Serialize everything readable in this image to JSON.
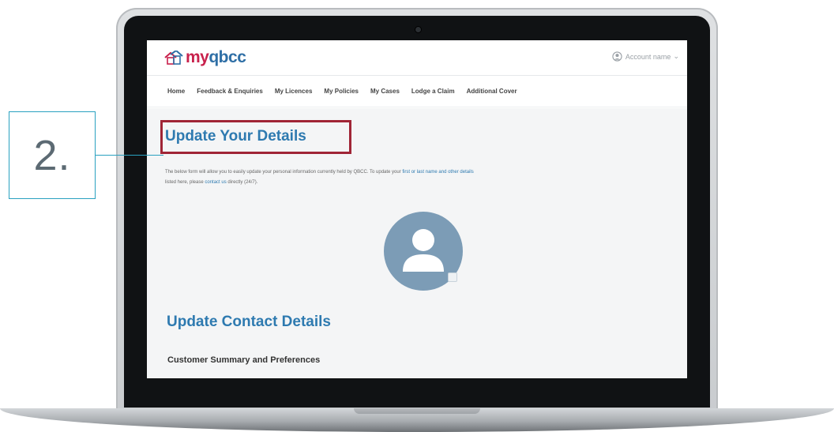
{
  "app": {
    "logo_text_my": "my",
    "logo_text_qbcc": "qbcc",
    "user_label": "Account name"
  },
  "nav": {
    "items": [
      "Home",
      "Feedback & Enquiries",
      "My Licences",
      "My Policies",
      "My Cases",
      "Lodge a Claim",
      "Additional Cover"
    ]
  },
  "page": {
    "title": "Update Your Details",
    "intro_part1": "The below form will allow you to easily update your personal information currently held by QBCC. To update your",
    "intro_link1": "first or last name and other details",
    "intro_part2": "listed here, please",
    "intro_link2": "contact us",
    "intro_part3": "directly (24/7).",
    "section_title": "Update Contact Details",
    "sub_title": "Customer Summary and Preferences"
  },
  "callout": {
    "number": "2."
  },
  "colors": {
    "brand_blue": "#2e7ab0",
    "brand_red": "#c8214c",
    "highlight_red": "#a02536",
    "callout_teal": "#2aa1c0",
    "avatar_blue": "#7c9cb6"
  },
  "icons": {
    "logo": "house-icon",
    "user": "user-circle-icon",
    "avatar": "person-icon",
    "edit": "edit-icon"
  }
}
